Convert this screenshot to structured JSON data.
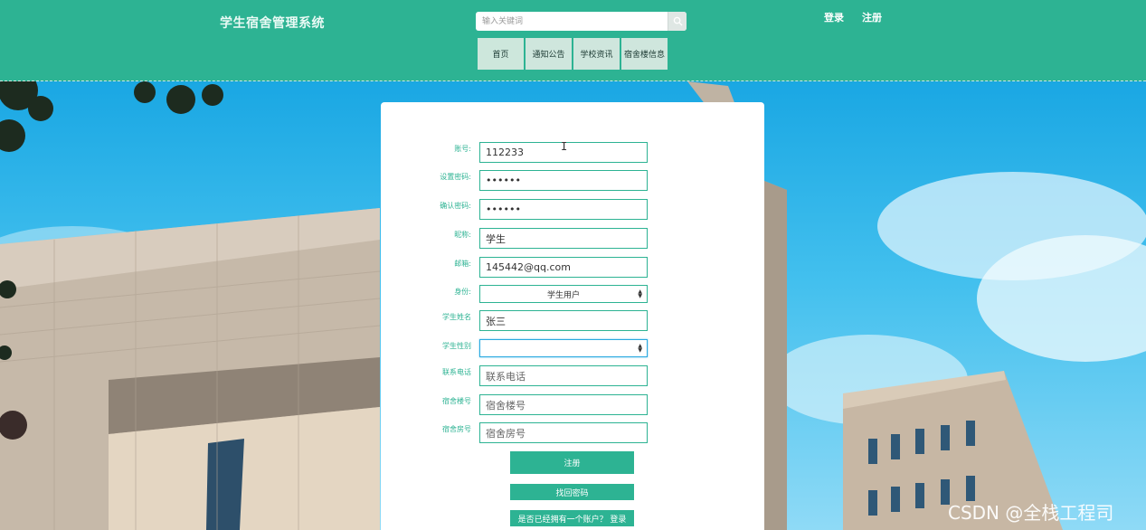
{
  "header": {
    "site_title": "学生宿舍管理系统",
    "search_placeholder": "输入关键词",
    "login_label": "登录",
    "register_label": "注册",
    "brand_color": "#2db393"
  },
  "nav": {
    "items": [
      {
        "label": "首页"
      },
      {
        "label": "通知公告"
      },
      {
        "label": "学校资讯"
      },
      {
        "label": "宿舍楼信息"
      }
    ]
  },
  "form": {
    "fields": [
      {
        "label": "账号:",
        "value": "112233"
      },
      {
        "label": "设置密码:",
        "value": "••••••"
      },
      {
        "label": "确认密码:",
        "value": "••••••"
      },
      {
        "label": "昵称:",
        "value": "学生"
      },
      {
        "label": "邮箱:",
        "value": "145442@qq.com"
      },
      {
        "label": "身份:",
        "value": "学生用户"
      },
      {
        "label": "学生姓名",
        "value": "张三"
      },
      {
        "label": "学生性别",
        "value": ""
      },
      {
        "label": "联系电话",
        "placeholder": "联系电话"
      },
      {
        "label": "宿舍楼号",
        "placeholder": "宿舍楼号"
      },
      {
        "label": "宿舍房号",
        "placeholder": "宿舍房号"
      }
    ],
    "submit_label": "注册",
    "forgot_label": "找回密码",
    "login_prompt": "是否已经拥有一个账户？ 登录"
  },
  "watermark": "CSDN @全栈工程司",
  "icons": {
    "search": "search-icon",
    "cursor": "text-cursor-icon"
  }
}
